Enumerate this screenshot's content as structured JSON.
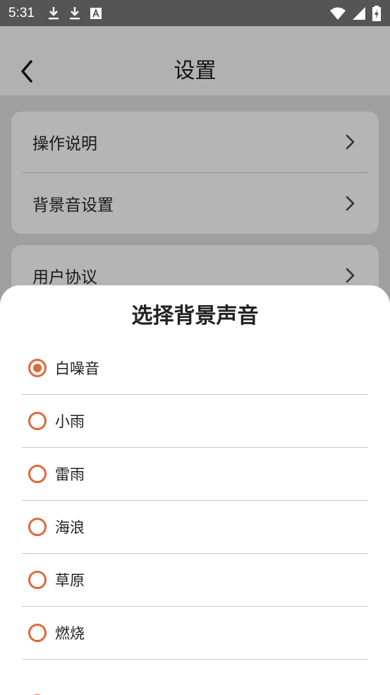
{
  "status_bar": {
    "time": "5:31",
    "left_icons": [
      "download-icon",
      "download-icon",
      "font-a-icon"
    ],
    "right_icons": [
      "wifi-icon",
      "signal-icon",
      "battery-charging-icon"
    ]
  },
  "header": {
    "title": "设置",
    "back_icon": "chevron-left-icon"
  },
  "settings": {
    "items": [
      {
        "label": "操作说明"
      },
      {
        "label": "背景音设置"
      },
      {
        "label": "用户协议"
      }
    ]
  },
  "sheet": {
    "title": "选择背景声音",
    "options": [
      {
        "label": "白噪音",
        "selected": true
      },
      {
        "label": "小雨",
        "selected": false
      },
      {
        "label": "雷雨",
        "selected": false
      },
      {
        "label": "海浪",
        "selected": false
      },
      {
        "label": "草原",
        "selected": false
      },
      {
        "label": "燃烧",
        "selected": false
      }
    ]
  },
  "colors": {
    "accent": "#e0683d",
    "overlay_header": "#b1b1b1",
    "overlay_body": "#9f9f9f",
    "status_bar": "#555555"
  }
}
